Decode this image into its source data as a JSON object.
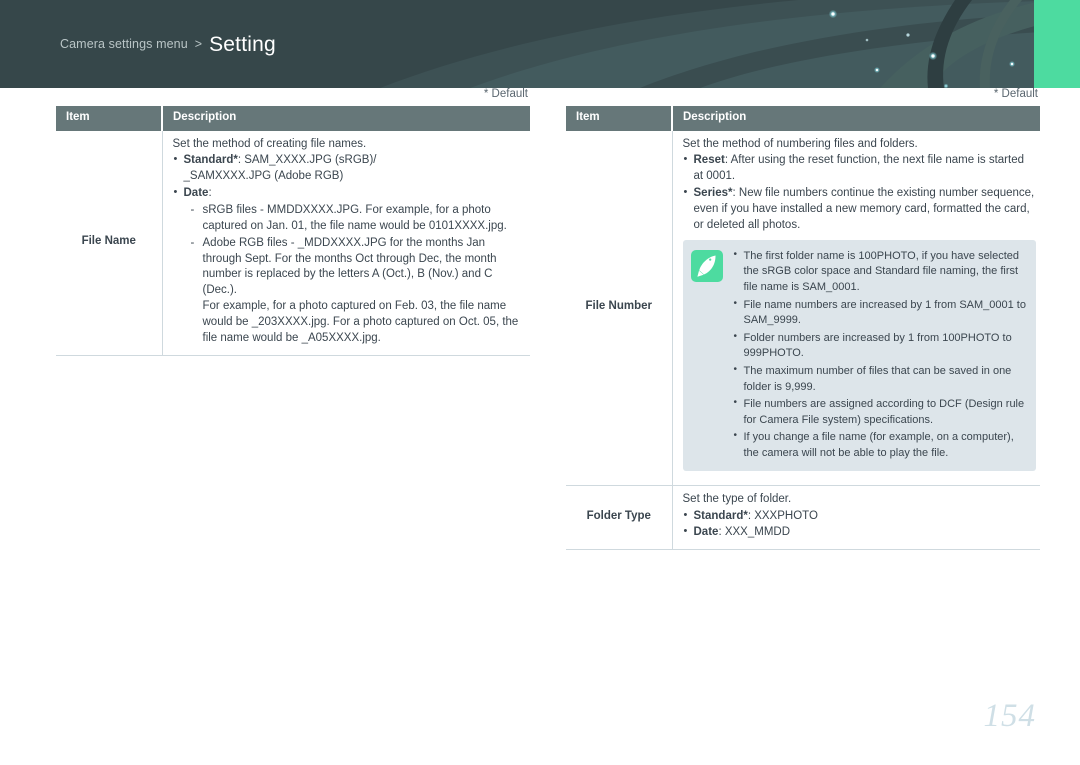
{
  "header": {
    "breadcrumb_prefix": "Camera settings menu",
    "breadcrumb_separator": ">",
    "title": "Setting",
    "bg_color": "#36474a",
    "accent_color": "#4ddba0"
  },
  "page_number": "154",
  "tables": {
    "left": {
      "default_marker": "* Default",
      "columns": [
        "Item",
        "Description"
      ],
      "rows": [
        {
          "item": "File Name",
          "lead": "Set the method of creating file names.",
          "bullets": [
            {
              "label": "Standard",
              "star": "*",
              "text": ": SAM_XXXX.JPG (sRGB)/",
              "cont": "_SAMXXXX.JPG (Adobe RGB)"
            },
            {
              "label": "Date",
              "star": "",
              "text": ":",
              "sub": [
                {
                  "text": "sRGB files - MMDDXXXX.JPG. For example, for a photo captured on Jan. 01, the file name would be 0101XXXX.jpg."
                },
                {
                  "text": "Adobe RGB files - _MDDXXXX.JPG for the months Jan through Sept. For the months Oct through Dec, the month number is replaced by the letters A (Oct.), B (Nov.) and C (Dec.).",
                  "para": "For example, for a photo captured on Feb. 03, the file name would be _203XXXX.jpg. For a photo captured on Oct. 05, the file name would be _A05XXXX.jpg."
                }
              ]
            }
          ]
        }
      ]
    },
    "right": {
      "default_marker": "* Default",
      "columns": [
        "Item",
        "Description"
      ],
      "rows": [
        {
          "item": "File Number",
          "lead": "Set the method of numbering files and folders.",
          "bullets": [
            {
              "label": "Reset",
              "star": "",
              "text": ": After using the reset function, the next file name is started at 0001."
            },
            {
              "label": "Series",
              "star": "*",
              "text": ": New file numbers continue the existing number sequence, even if you have installed a new memory card, formatted the card, or deleted all photos."
            }
          ],
          "note": {
            "icon": "pencil-note-icon",
            "icon_bg": "#4ddba0",
            "box_bg": "#dde5ea",
            "items": [
              "The first folder name is 100PHOTO, if you have selected the sRGB color space and Standard file naming, the first file name is SAM_0001.",
              "File name numbers are increased by 1 from SAM_0001 to SAM_9999.",
              "Folder numbers are increased by 1 from 100PHOTO to 999PHOTO.",
              "The maximum number of files that can be saved in one folder is 9,999.",
              "File numbers are assigned according to DCF (Design rule for Camera File system) specifications.",
              "If you change a file name (for example, on a computer), the camera will not be able to play the file."
            ]
          }
        },
        {
          "item": "Folder Type",
          "lead": "Set the type of folder.",
          "bullets": [
            {
              "label": "Standard",
              "star": "*",
              "text": ": XXXPHOTO"
            },
            {
              "label": "Date",
              "star": "",
              "text": ": XXX_MMDD"
            }
          ]
        }
      ]
    }
  }
}
